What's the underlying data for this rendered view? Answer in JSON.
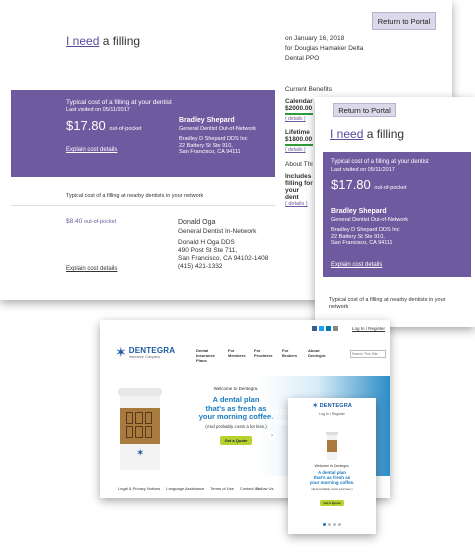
{
  "cardA": {
    "title_link": "I need",
    "title_rest": "a filling",
    "portal_button": "Return to Portal",
    "date_line": "on January 16, 2018",
    "for_line": "for Douglas Hamaker Delta",
    "plan_line": "Dental PPO",
    "purple": {
      "heading": "Typical cost of a filling at your dentist",
      "last_visited": "Last visited on 05/11/2017",
      "price": "$17.80",
      "price_suffix": "out-of-pocket",
      "dentist_name": "Bradley Shepard",
      "dentist_role": "General Dentist  Out-of-Network",
      "practice": "Bradley D Shepard DDS Inc",
      "address1": "22 Battery St Ste 910,",
      "address2": "San Francisco, CA  94111",
      "explain": "Explain cost details"
    },
    "benefits": {
      "heading": "Current Benefits",
      "calendar_label": "Calendar",
      "calendar_value": "$2000.00",
      "details1": "( details )",
      "lifetime_label": "Lifetime",
      "lifetime_value": "$1800.00",
      "details2": "( details )",
      "about": "About Thi",
      "includes": "Includes",
      "filling_for": "filling for",
      "your": "your",
      "dent": "dent",
      "details3": "( details )"
    },
    "nearby_heading": "Typical cost of a filling at nearby dentists in your network",
    "nearby": {
      "price": "$8.40",
      "price_suffix": "out-of-pocket",
      "dentist_name": "Donald Oga",
      "dentist_role": "General Dentist  In-Network",
      "practice": "Donald H Oga DDS",
      "address1": "490 Post St Ste 711,",
      "address2": "San Francisco, CA  94102-1408",
      "phone": "(415) 421-1332",
      "explain": "Explain cost details"
    }
  },
  "cardB": {
    "portal_button": "Return to Portal",
    "title_link": "I need",
    "title_rest": "a filling",
    "purple": {
      "heading": "Typical cost of a filling at your dentist",
      "last_visited": "Last visited on 05/11/2017",
      "price": "$17.80",
      "price_suffix": "out-of-pocket",
      "dentist_name": "Bradley Shepard",
      "dentist_role": "General Dentist  Out-of-Network",
      "practice": "Bradley D Shepard DDS Inc",
      "address1": "22 Battery St Ste 910,",
      "address2": "San Francisco, CA  94111",
      "explain": "Explain cost details"
    },
    "nearby_heading": "Typical cost of a filling at nearby dentists in your network"
  },
  "cardC": {
    "topbar": {
      "login": "Log In / Register",
      "search": "Search This Site"
    },
    "logo": "DENTEGRA",
    "logo_sub": "Insurance Company",
    "nav": [
      "Dental Insurance Plans",
      "For Members",
      "For Providers",
      "For Brokers",
      "About Dentegra"
    ],
    "welcome": "Welcome to Dentegra.",
    "headline1": "A dental plan",
    "headline2": "that's as fresh as",
    "headline3": "your morning coffee.",
    "sub": "(And probably costs a lot less.)",
    "cta": "Get a Quote",
    "side_text1": "Denta",
    "side_text2": "Plans",
    "footer": [
      "Legal & Privacy Notices",
      "Language Assistance",
      "Terms of Use",
      "Contact Us"
    ],
    "follow": "Follow Us"
  },
  "cardD": {
    "logo": "DENTEGRA",
    "login": "Log In / Register",
    "welcome": "Welcome to Dentegra.",
    "headline1": "A dental plan",
    "headline2": "that's as fresh as",
    "headline3": "your morning coffee.",
    "sub": "(And probably costs a lot less.)",
    "cta": "Get a Quote"
  },
  "colors": {
    "purple": "#6e5a9e",
    "accent_blue": "#1a7abf",
    "green": "#b7d22e"
  }
}
